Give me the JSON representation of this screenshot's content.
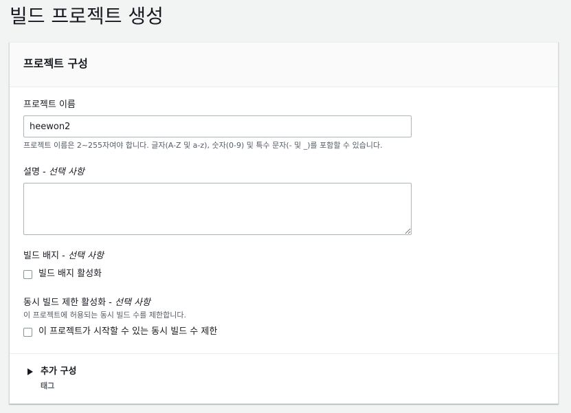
{
  "page": {
    "title": "빌드 프로젝트 생성"
  },
  "panel": {
    "title": "프로젝트 구성"
  },
  "project_name": {
    "label": "프로젝트 이름",
    "value": "heewon2",
    "hint": "프로젝트 이름은 2~255자여야 합니다. 글자(A-Z 및 a-z), 숫자(0-9) 및 특수 문자(- 및 _)를 포함할 수 있습니다."
  },
  "description": {
    "label": "설명",
    "optional": "선택 사항",
    "value": ""
  },
  "build_badge": {
    "label": "빌드 배지",
    "optional": "선택 사항",
    "checkbox_label": "빌드 배지 활성화",
    "checked": false
  },
  "concurrent_limit": {
    "label": "동시 빌드 제한 활성화",
    "optional": "선택 사항",
    "hint": "이 프로젝트에 허용되는 동시 빌드 수를 제한합니다.",
    "checkbox_label": "이 프로젝트가 시작할 수 있는 동시 빌드 수 제한",
    "checked": false
  },
  "additional_config": {
    "label": "추가 구성",
    "sub_label": "태그",
    "icon": "caret-right-icon"
  },
  "colors": {
    "background": "#f2f3f3",
    "panel": "#ffffff",
    "text": "#16191f",
    "hint": "#545b64",
    "border": "#aab7b8"
  }
}
